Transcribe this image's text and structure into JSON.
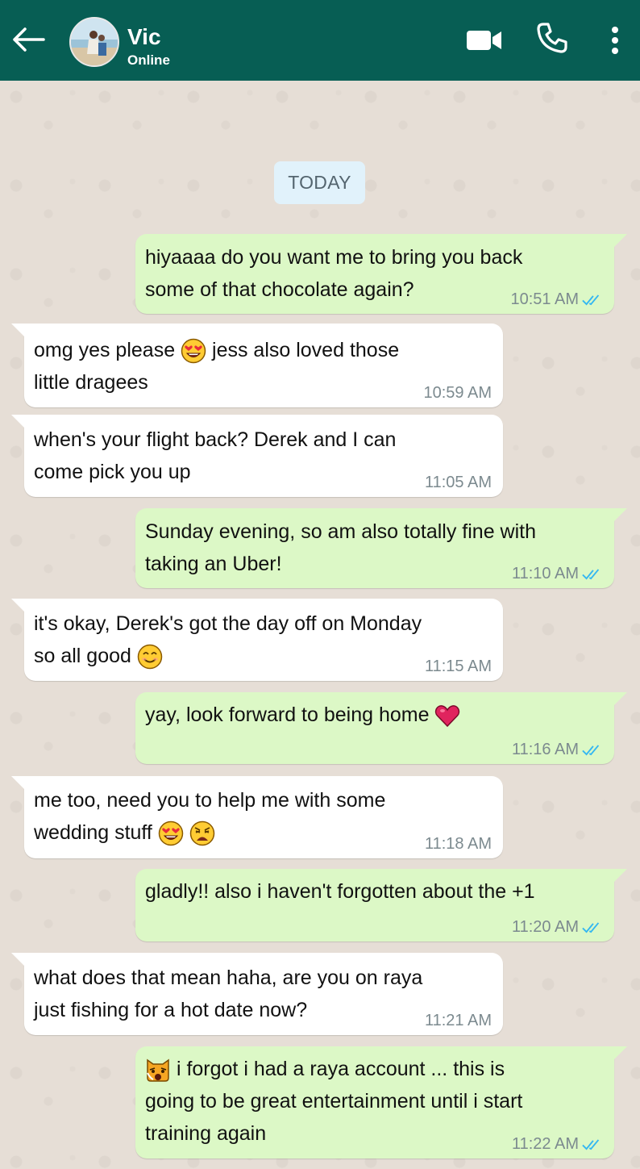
{
  "header": {
    "contact_name": "Vic",
    "status": "Online",
    "icons": {
      "back": "back-arrow-icon",
      "video": "video-call-icon",
      "call": "phone-icon",
      "menu": "more-vertical-icon"
    },
    "background_color": "#075e54"
  },
  "chat": {
    "date_label": "TODAY",
    "colors": {
      "outgoing": "#dcf8c6",
      "incoming": "#ffffff",
      "read_ticks": "#34b7f1"
    },
    "messages": [
      {
        "direction": "out",
        "text": "hiyaaaa do you want me to bring you back\nsome of that chocolate again?",
        "time": "10:51 AM",
        "status": "read"
      },
      {
        "direction": "in",
        "text_before": "omg yes please",
        "emoji": "heart-eyes-emoji",
        "text_after": "jess also loved those\nlittle dragees",
        "time": "10:59 AM"
      },
      {
        "direction": "in",
        "text": "when's your flight back? Derek and I can\ncome pick you up",
        "time": "11:05 AM"
      },
      {
        "direction": "out",
        "text": "Sunday evening, so am also totally fine with\ntaking an Uber!",
        "time": "11:10 AM",
        "status": "read"
      },
      {
        "direction": "in",
        "text": "it's okay, Derek's got the day off on Monday\nso all good",
        "emoji": "smiling-face-emoji",
        "time": "11:15 AM"
      },
      {
        "direction": "out",
        "text": "yay, look forward to being home",
        "emoji": "red-heart-emoji",
        "time": "11:16 AM",
        "status": "read"
      },
      {
        "direction": "in",
        "text": "me too, need you to help me with some\nwedding stuff",
        "emojis": [
          "heart-eyes-emoji",
          "weary-face-emoji"
        ],
        "time": "11:18 AM"
      },
      {
        "direction": "out",
        "text": "gladly!! also i haven't forgotten about the +1",
        "time": "11:20 AM",
        "status": "read"
      },
      {
        "direction": "in",
        "text": "what does that mean haha, are you on raya\njust fishing for a hot date now?",
        "time": "11:21 AM"
      },
      {
        "direction": "out",
        "emoji": "weary-cat-emoji",
        "text": "i forgot i had a raya account ... this is\ngoing to be great entertainment until i start\ntraining again",
        "time": "11:22 AM",
        "status": "read"
      }
    ]
  }
}
